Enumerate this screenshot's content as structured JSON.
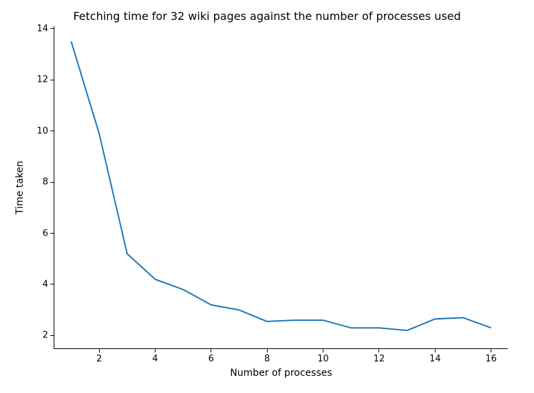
{
  "chart_data": {
    "type": "line",
    "title": "Fetching time for 32 wiki pages against the number of processes used",
    "xlabel": "Number of processes",
    "ylabel": "Time taken",
    "xlim": [
      0.4,
      16.6
    ],
    "ylim": [
      1.5,
      14.1
    ],
    "x_ticks": [
      2,
      4,
      6,
      8,
      10,
      12,
      14,
      16
    ],
    "y_ticks": [
      2,
      4,
      6,
      8,
      10,
      12,
      14
    ],
    "series": [
      {
        "name": "time",
        "x": [
          1,
          2,
          3,
          4,
          5,
          6,
          7,
          8,
          9,
          10,
          11,
          12,
          13,
          14,
          15,
          16
        ],
        "y": [
          13.5,
          9.9,
          5.2,
          4.2,
          3.8,
          3.2,
          3.0,
          2.55,
          2.6,
          2.6,
          2.3,
          2.3,
          2.2,
          2.65,
          2.7,
          2.3
        ]
      }
    ],
    "colors": {
      "line": "#1f77b4"
    }
  }
}
